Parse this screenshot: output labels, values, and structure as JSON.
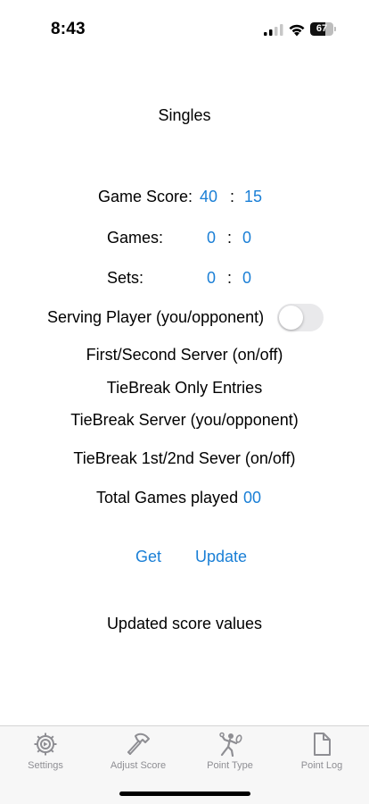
{
  "status_bar": {
    "time": "8:43",
    "battery": "67",
    "battery_level": 0.67
  },
  "title": "Singles",
  "game_score": {
    "label": "Game Score:",
    "player": "40",
    "separator": ":",
    "opponent": "15"
  },
  "games": {
    "label": "Games:",
    "player": "0",
    "separator": ":",
    "opponent": "0"
  },
  "sets": {
    "label": "Sets:",
    "player": "0",
    "separator": ":",
    "opponent": "0"
  },
  "serving": {
    "label": "Serving Player (you/opponent)",
    "toggle_on": false
  },
  "first_second_server": "First/Second Server (on/off)",
  "tiebreak_only": "TieBreak Only Entries",
  "tiebreak_server": "TieBreak Server (you/opponent)",
  "tiebreak_first_second": "TieBreak 1st/2nd Sever (on/off)",
  "total_games": {
    "label": "Total Games played",
    "value": "00"
  },
  "actions": {
    "get": "Get",
    "update": "Update"
  },
  "updated_message": "Updated score values",
  "tab_bar": {
    "items": [
      {
        "label": "Settings",
        "icon": "gear-icon"
      },
      {
        "label": "Adjust Score",
        "icon": "hammer-icon"
      },
      {
        "label": "Point Type",
        "icon": "tennis-player-icon"
      },
      {
        "label": "Point Log",
        "icon": "document-icon"
      }
    ]
  }
}
